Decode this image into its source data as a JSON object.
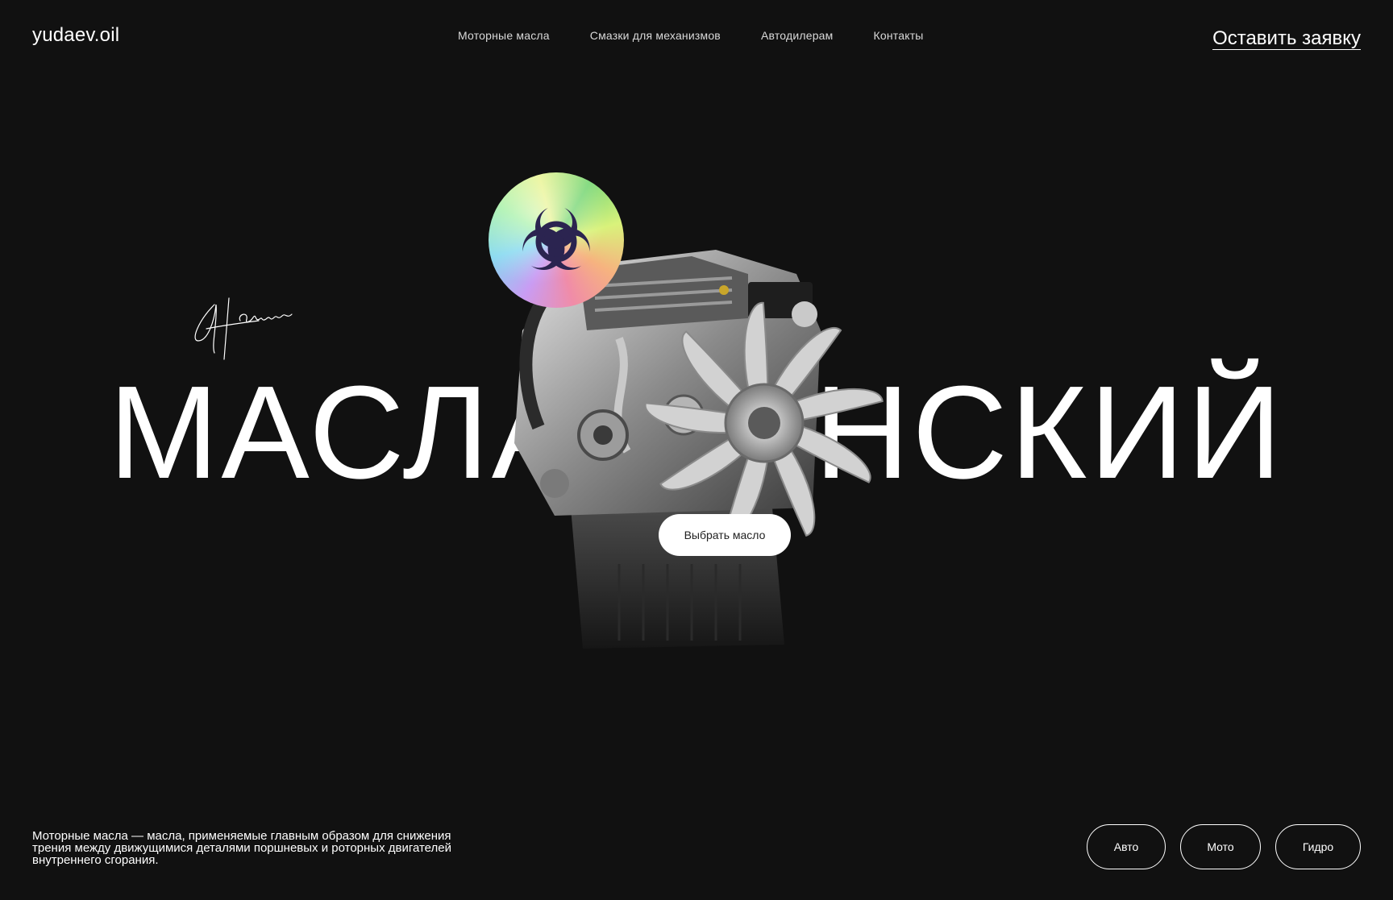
{
  "header": {
    "logo": "yudaev.oil",
    "nav": [
      {
        "label": "Моторные масла"
      },
      {
        "label": "Смазки для механизмов"
      },
      {
        "label": "Автодилерам"
      },
      {
        "label": "Контакты"
      }
    ],
    "cta_label": "Оставить заявку"
  },
  "hero": {
    "title": "МАСЛА ОЧНСКИЙ",
    "button_label": "Выбрать масло",
    "badge_icon": "biohazard-icon",
    "signature_icon": "signature-icon",
    "engine_image": "engine-image"
  },
  "footer": {
    "description": "Моторные масла — масла, применяемые главным образом для снижения трения между движущимися деталями поршневых и роторных двигателей внутреннего сгорания.",
    "filters": [
      {
        "label": "Авто"
      },
      {
        "label": "Мото"
      },
      {
        "label": "Гидро"
      }
    ]
  },
  "colors": {
    "background": "#111111",
    "text": "#ffffff",
    "button_bg": "#ffffff",
    "button_text": "#222222"
  }
}
